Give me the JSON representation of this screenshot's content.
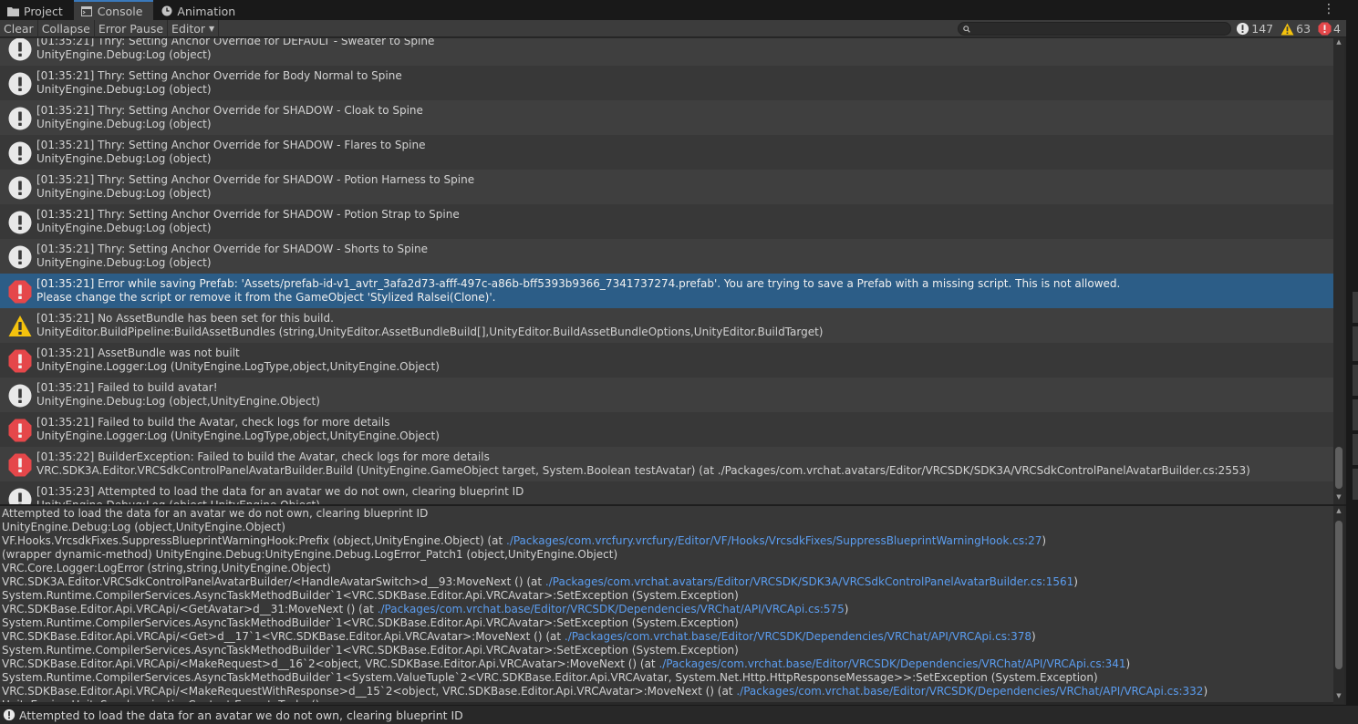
{
  "tabs": [
    {
      "label": "Project",
      "icon": "folder-icon",
      "active": false
    },
    {
      "label": "Console",
      "icon": "console-icon",
      "active": true
    },
    {
      "label": "Animation",
      "icon": "clock-icon",
      "active": false
    }
  ],
  "toolbar": {
    "clear_label": "Clear",
    "collapse_label": "Collapse",
    "error_pause_label": "Error Pause",
    "editor_label": "Editor",
    "search_value": ""
  },
  "counters": {
    "info_count": "147",
    "warning_count": "63",
    "error_count": "4"
  },
  "colors": {
    "accent": "#3a79bb",
    "selected_row": "#2c5d87",
    "error_red": "#e5474a",
    "warning_yellow": "#f4c20d",
    "info_white": "#e8e8e8",
    "link_blue": "#5b9df0"
  },
  "log_entries": [
    {
      "type": "info",
      "line1": "[01:35:21] Thry: Setting Anchor Override for DEFAULT - Sweater to Spine",
      "line2": "UnityEngine.Debug:Log (object)"
    },
    {
      "type": "info",
      "line1": "[01:35:21] Thry: Setting Anchor Override for Body Normal to Spine",
      "line2": "UnityEngine.Debug:Log (object)"
    },
    {
      "type": "info",
      "line1": "[01:35:21] Thry: Setting Anchor Override for SHADOW - Cloak to Spine",
      "line2": "UnityEngine.Debug:Log (object)"
    },
    {
      "type": "info",
      "line1": "[01:35:21] Thry: Setting Anchor Override for SHADOW - Flares to Spine",
      "line2": "UnityEngine.Debug:Log (object)"
    },
    {
      "type": "info",
      "line1": "[01:35:21] Thry: Setting Anchor Override for SHADOW - Potion Harness to Spine",
      "line2": "UnityEngine.Debug:Log (object)"
    },
    {
      "type": "info",
      "line1": "[01:35:21] Thry: Setting Anchor Override for SHADOW - Potion Strap to Spine",
      "line2": "UnityEngine.Debug:Log (object)"
    },
    {
      "type": "info",
      "line1": "[01:35:21] Thry: Setting Anchor Override for SHADOW - Shorts to Spine",
      "line2": "UnityEngine.Debug:Log (object)"
    },
    {
      "type": "error",
      "selected": true,
      "line1": "[01:35:21] Error while saving Prefab: 'Assets/prefab-id-v1_avtr_3afa2d73-afff-497c-a86b-bff5393b9366_7341737274.prefab'. You are trying to save a Prefab with a missing script. This is not allowed.",
      "line2": "Please change the script or remove it from the GameObject 'Stylized Ralsei(Clone)'."
    },
    {
      "type": "warning",
      "line1": "[01:35:21] No AssetBundle has been set for this build.",
      "line2": "UnityEditor.BuildPipeline:BuildAssetBundles (string,UnityEditor.AssetBundleBuild[],UnityEditor.BuildAssetBundleOptions,UnityEditor.BuildTarget)"
    },
    {
      "type": "error",
      "line1": "[01:35:21] AssetBundle was not built",
      "line2": "UnityEngine.Logger:Log (UnityEngine.LogType,object,UnityEngine.Object)"
    },
    {
      "type": "info",
      "line1": "[01:35:21] Failed to build avatar!",
      "line2": "UnityEngine.Debug:Log (object,UnityEngine.Object)"
    },
    {
      "type": "error",
      "line1": "[01:35:21] Failed to build the Avatar, check logs for more details",
      "line2": "UnityEngine.Logger:Log (UnityEngine.LogType,object,UnityEngine.Object)"
    },
    {
      "type": "error",
      "line1": "[01:35:22] BuilderException: Failed to build the Avatar, check logs for more details",
      "line2": "VRC.SDK3A.Editor.VRCSdkControlPanelAvatarBuilder.Build (UnityEngine.GameObject target, System.Boolean testAvatar) (at ./Packages/com.vrchat.avatars/Editor/VRCSDK/SDK3A/VRCSdkControlPanelAvatarBuilder.cs:2553)"
    },
    {
      "type": "info",
      "line1": "[01:35:23] Attempted to load the data for an avatar we do not own, clearing blueprint ID",
      "line2": "UnityEngine.Debug:Log (object,UnityEngine.Object)"
    }
  ],
  "detail_lines": [
    {
      "text": "Attempted to load the data for an avatar we do not own, clearing blueprint ID",
      "link": ""
    },
    {
      "text": "UnityEngine.Debug:Log (object,UnityEngine.Object)",
      "link": ""
    },
    {
      "text": "VF.Hooks.VrcsdkFixes.SuppressBlueprintWarningHook:Prefix (object,UnityEngine.Object) (at ",
      "link": "./Packages/com.vrcfury.vrcfury/Editor/VF/Hooks/VrcsdkFixes/SuppressBlueprintWarningHook.cs:27",
      "suffix": ")"
    },
    {
      "text": "(wrapper dynamic-method) UnityEngine.Debug:UnityEngine.Debug.LogError_Patch1 (object,UnityEngine.Object)",
      "link": ""
    },
    {
      "text": "VRC.Core.Logger:LogError (string,string,UnityEngine.Object)",
      "link": ""
    },
    {
      "text": "VRC.SDK3A.Editor.VRCSdkControlPanelAvatarBuilder/<HandleAvatarSwitch>d__93:MoveNext () (at ",
      "link": "./Packages/com.vrchat.avatars/Editor/VRCSDK/SDK3A/VRCSdkControlPanelAvatarBuilder.cs:1561",
      "suffix": ")"
    },
    {
      "text": "System.Runtime.CompilerServices.AsyncTaskMethodBuilder`1<VRC.SDKBase.Editor.Api.VRCAvatar>:SetException (System.Exception)",
      "link": ""
    },
    {
      "text": "VRC.SDKBase.Editor.Api.VRCApi/<GetAvatar>d__31:MoveNext () (at ",
      "link": "./Packages/com.vrchat.base/Editor/VRCSDK/Dependencies/VRChat/API/VRCApi.cs:575",
      "suffix": ")"
    },
    {
      "text": "System.Runtime.CompilerServices.AsyncTaskMethodBuilder`1<VRC.SDKBase.Editor.Api.VRCAvatar>:SetException (System.Exception)",
      "link": ""
    },
    {
      "text": "VRC.SDKBase.Editor.Api.VRCApi/<Get>d__17`1<VRC.SDKBase.Editor.Api.VRCAvatar>:MoveNext () (at ",
      "link": "./Packages/com.vrchat.base/Editor/VRCSDK/Dependencies/VRChat/API/VRCApi.cs:378",
      "suffix": ")"
    },
    {
      "text": "System.Runtime.CompilerServices.AsyncTaskMethodBuilder`1<VRC.SDKBase.Editor.Api.VRCAvatar>:SetException (System.Exception)",
      "link": ""
    },
    {
      "text": "VRC.SDKBase.Editor.Api.VRCApi/<MakeRequest>d__16`2<object, VRC.SDKBase.Editor.Api.VRCAvatar>:MoveNext () (at ",
      "link": "./Packages/com.vrchat.base/Editor/VRCSDK/Dependencies/VRChat/API/VRCApi.cs:341",
      "suffix": ")"
    },
    {
      "text": "System.Runtime.CompilerServices.AsyncTaskMethodBuilder`1<System.ValueTuple`2<VRC.SDKBase.Editor.Api.VRCAvatar, System.Net.Http.HttpResponseMessage>>:SetException (System.Exception)",
      "link": ""
    },
    {
      "text": "VRC.SDKBase.Editor.Api.VRCApi/<MakeRequestWithResponse>d__15`2<object, VRC.SDKBase.Editor.Api.VRCAvatar>:MoveNext () (at ",
      "link": "./Packages/com.vrchat.base/Editor/VRCSDK/Dependencies/VRChat/API/VRCApi.cs:332",
      "suffix": ")"
    },
    {
      "text": "UnityEngine.UnitySynchronizationContext:ExecuteTasks ()",
      "link": ""
    }
  ],
  "status_bar": {
    "message": "Attempted to load the data for an avatar we do not own, clearing blueprint ID",
    "icon": "info-icon"
  }
}
